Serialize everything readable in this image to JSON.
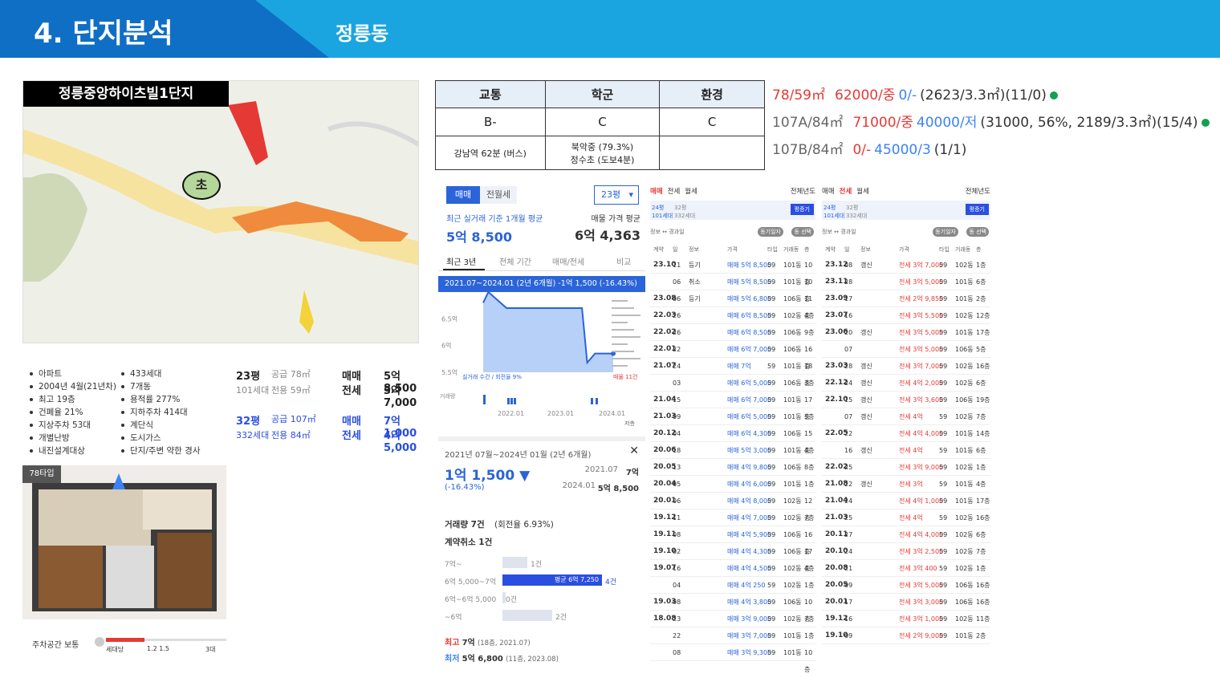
{
  "header": {
    "title": "4. 단지분석",
    "subtitle": "정릉동"
  },
  "map": {
    "label": "정릉중앙하이츠빌1단지",
    "school_marker": "초"
  },
  "info": {
    "left": [
      "아파트",
      "2004년 4월(21년차)",
      "최고 19층",
      "건폐율 21%",
      "지상주차 53대",
      "개별난방",
      "내진설계대상"
    ],
    "right": [
      "433세대",
      "7개동",
      "용적률 277%",
      "지하주차 414대",
      "계단식",
      "도시가스",
      "단지/주변 약한 경사"
    ]
  },
  "units": [
    {
      "py": "23평",
      "sub": "101세대",
      "supply": "공급 78㎡",
      "excl": "전용 59㎡",
      "t1": "매매",
      "p1": "5억 8,500",
      "t2": "전세",
      "p2": "3억 7,000",
      "hl": false
    },
    {
      "py": "32평",
      "sub": "332세대",
      "supply": "공급 107㎡",
      "excl": "전용 84㎡",
      "t1": "매매",
      "p1": "7억 1,000",
      "t2": "전세",
      "p2": "4억 5,000",
      "hl": true
    }
  ],
  "floor_tag": "78타입",
  "parking": {
    "label": "주차공간 보통",
    "per": "세대당",
    "ticks": "1.2 1.5",
    "max": "3대"
  },
  "env": {
    "headers": [
      "교통",
      "학군",
      "환경"
    ],
    "grades": [
      "B-",
      "C",
      "C"
    ],
    "details": [
      "강남역 62분 (버스)",
      "북악중 (79.3%)",
      "정수초 (도보4분)",
      ""
    ]
  },
  "types": [
    {
      "type": "78/59㎡",
      "sale": "62000/중",
      "rent": "0/-",
      "extra": "(2623/3.3㎡)(11/0)",
      "dot": true,
      "color": "#e53935"
    },
    {
      "type": "107A/84㎡",
      "sale": "71000/중",
      "rent": "40000/저",
      "extra": "(31000, 56%, 2189/3.3㎡)(15/4)",
      "dot": true,
      "color": "#666"
    },
    {
      "type": "107B/84㎡",
      "sale": "0/-",
      "rent": "45000/3",
      "extra": "(1/1)",
      "dot": false,
      "color": "#666"
    }
  ],
  "price_panel": {
    "tabs": [
      "매매",
      "전월세"
    ],
    "size_select": "23평",
    "recent_label": "최근 실거래 기준 1개월 평균",
    "recent_value": "5억 8,500",
    "ask_label": "매물 가격 평균",
    "ask_value": "6억 4,363",
    "period_tabs": [
      "최근 3년",
      "전체 기간",
      "매매/전세",
      "비교"
    ],
    "banner": "2021.07~2024.01 (2년 6개월)  -1억 1,500 (-16.43%)",
    "y_ticks": [
      "6.5억",
      "6억",
      "5.5억"
    ],
    "x_ticks": [
      "2022.01",
      "2023.01",
      "2024.01"
    ],
    "vol_label": "거래량",
    "legend": "실거래 수건 / 회전율 9%",
    "max_label": "최저",
    "ask_tag": "매물 11건",
    "note": "저층",
    "summary_period": "2021년 07월~2024년 01월 (2년 6개월)",
    "change": "1억 1,500 ▼",
    "change_pct": "(-16.43%)",
    "from_date": "2021.07",
    "from_val": "7억",
    "to_date": "2024.01",
    "to_val": "5억 8,500",
    "volume": "거래량 7건",
    "turnover": "(회전율 6.93%)",
    "cancel": "계약취소 1건",
    "bars": [
      {
        "label": "7억~",
        "count": "1건",
        "frac": 0.25
      },
      {
        "label": "6억 5,000~7억",
        "count": "4건",
        "frac": 1,
        "avg": "평균 6억 7,250"
      },
      {
        "label": "6억~6억 5,000",
        "count": "0건",
        "frac": 0
      },
      {
        "label": "~6억",
        "count": "2건",
        "frac": 0.5
      }
    ],
    "high": {
      "k": "최고",
      "v": "7억",
      "d": "(18층, 2021.07)"
    },
    "low": {
      "k": "최저",
      "v": "5억 6,800",
      "d": "(11층, 2023.08)"
    }
  },
  "chart_data": {
    "type": "line",
    "title": "",
    "x": [
      "2021.07",
      "2021.08",
      "2021.09",
      "2022.01",
      "2022.06",
      "2023.01",
      "2023.06",
      "2023.08",
      "2023.10",
      "2024.01"
    ],
    "values": [
      6.8,
      7.0,
      6.7,
      6.7,
      6.7,
      6.7,
      6.7,
      5.68,
      5.85,
      5.85
    ],
    "yunit": "억",
    "ylim": [
      5.5,
      7.0
    ]
  },
  "tx_left": {
    "tabs": [
      "매매",
      "전세",
      "월세"
    ],
    "year": "전체년도",
    "size_py": "24평",
    "size_sub": "101세대",
    "size2_py": "32평",
    "size2_sub": "332세대",
    "btn": "평증기",
    "info": "정보 ↔ 경과일",
    "b1": "동기일자",
    "b2": "동 선택",
    "cols": [
      "계약",
      "일",
      "정보",
      "가격",
      "타입",
      "거래동",
      "층"
    ],
    "rows": [
      [
        "23.10",
        "11",
        "등기",
        "매매 5억 8,500",
        "59",
        "101동",
        "10층"
      ],
      [
        "",
        "06",
        "취소",
        "매매 5억 8,500",
        "59",
        "101동",
        "10층"
      ],
      [
        "23.08",
        "06",
        "등기",
        "매매 5억 6,800",
        "59",
        "106동",
        "11층"
      ],
      [
        "22.03",
        "26",
        "",
        "매매 6억 8,500",
        "59",
        "102동",
        "4층"
      ],
      [
        "22.02",
        "26",
        "",
        "매매 6억 8,500",
        "59",
        "106동",
        "9층"
      ],
      [
        "22.01",
        "22",
        "",
        "매매 6억 7,000",
        "59",
        "106동",
        "16층"
      ],
      [
        "21.07",
        "24",
        "",
        "매매 7억",
        "59",
        "101동",
        "18층"
      ],
      [
        "",
        "03",
        "",
        "매매 6억 5,000",
        "59",
        "106동",
        "3층"
      ],
      [
        "21.04",
        "15",
        "",
        "매매 6억 7,000",
        "59",
        "101동",
        "17층"
      ],
      [
        "21.03",
        "09",
        "",
        "매매 6억 5,000",
        "59",
        "101동",
        "5층"
      ],
      [
        "20.12",
        "04",
        "",
        "매매 6억 4,300",
        "59",
        "106동",
        "15층"
      ],
      [
        "20.06",
        "18",
        "",
        "매매 5억 3,000",
        "59",
        "101동",
        "4층"
      ],
      [
        "20.05",
        "13",
        "",
        "매매 4억 9,800",
        "59",
        "106동",
        "8층"
      ],
      [
        "20.04",
        "05",
        "",
        "매매 4억 6,000",
        "59",
        "101동",
        "1층"
      ],
      [
        "20.01",
        "06",
        "",
        "매매 4억 8,000",
        "59",
        "102동",
        "12층"
      ],
      [
        "19.12",
        "11",
        "",
        "매매 4억 7,000",
        "59",
        "102동",
        "7층"
      ],
      [
        "19.11",
        "08",
        "",
        "매매 4억 5,900",
        "59",
        "106동",
        "16층"
      ],
      [
        "19.10",
        "02",
        "",
        "매매 4억 4,300",
        "59",
        "106동",
        "17층"
      ],
      [
        "19.07",
        "16",
        "",
        "매매 4억 4,500",
        "59",
        "102동",
        "4층"
      ],
      [
        "",
        "04",
        "",
        "매매 4억 250",
        "59",
        "102동",
        "1층"
      ],
      [
        "19.03",
        "08",
        "",
        "매매 4억 3,800",
        "59",
        "106동",
        "10층"
      ],
      [
        "18.08",
        "23",
        "",
        "매매 3억 9,000",
        "59",
        "102동",
        "7층"
      ],
      [
        "",
        "22",
        "",
        "매매 3억 7,000",
        "59",
        "101동",
        "1층"
      ],
      [
        "",
        "08",
        "",
        "매매 3억 9,300",
        "59",
        "101동",
        "10층"
      ]
    ]
  },
  "tx_right": {
    "tabs": [
      "매매",
      "전세",
      "월세"
    ],
    "year": "전체년도",
    "size_py": "24평",
    "size_sub": "101세대",
    "size2_py": "32평",
    "size2_sub": "332세대",
    "btn": "평증기",
    "info": "정보 ↔ 경과일",
    "b1": "동기일자",
    "b2": "동 선택",
    "cols": [
      "계약",
      "일",
      "정보",
      "가격",
      "타입",
      "거래동",
      "층"
    ],
    "rows": [
      [
        "23.12",
        "08",
        "갱신",
        "전세 3억 7,000",
        "59",
        "102동",
        "1층"
      ],
      [
        "23.11",
        "28",
        "",
        "전세 3억 5,000",
        "59",
        "101동",
        "6층"
      ],
      [
        "23.09",
        "17",
        "",
        "전세 2억 9,850",
        "59",
        "101동",
        "2층"
      ],
      [
        "23.07",
        "16",
        "",
        "전세 3억 5,500",
        "59",
        "102동",
        "12층"
      ],
      [
        "23.06",
        "20",
        "갱신",
        "전세 3억 5,000",
        "59",
        "101동",
        "17층"
      ],
      [
        "",
        "07",
        "",
        "전세 3억 5,000",
        "59",
        "106동",
        "5층"
      ],
      [
        "23.03",
        "28",
        "갱신",
        "전세 3억 7,000",
        "59",
        "102동",
        "16층"
      ],
      [
        "22.12",
        "24",
        "갱신",
        "전세 4억 2,000",
        "59",
        "102동",
        "6층"
      ],
      [
        "22.10",
        "15",
        "갱신",
        "전세 3억 3,600",
        "59",
        "106동",
        "19층"
      ],
      [
        "",
        "07",
        "갱신",
        "전세 4억",
        "59",
        "102동",
        "7층"
      ],
      [
        "22.05",
        "22",
        "",
        "전세 4억 4,000",
        "59",
        "101동",
        "14층"
      ],
      [
        "",
        "16",
        "갱신",
        "전세 4억",
        "59",
        "101동",
        "6층"
      ],
      [
        "22.02",
        "25",
        "",
        "전세 3억 9,000",
        "59",
        "102동",
        "1층"
      ],
      [
        "21.08",
        "22",
        "갱신",
        "전세 3억",
        "59",
        "101동",
        "4층"
      ],
      [
        "21.04",
        "24",
        "",
        "전세 4억 1,000",
        "59",
        "101동",
        "17층"
      ],
      [
        "21.03",
        "25",
        "",
        "전세 4억",
        "59",
        "102동",
        "16층"
      ],
      [
        "20.11",
        "27",
        "",
        "전세 4억 4,000",
        "59",
        "102동",
        "6층"
      ],
      [
        "20.10",
        "24",
        "",
        "전세 3억 2,500",
        "59",
        "102동",
        "7층"
      ],
      [
        "20.08",
        "21",
        "",
        "전세 3억 400",
        "59",
        "102동",
        "1층"
      ],
      [
        "20.05",
        "09",
        "",
        "전세 3억 5,000",
        "59",
        "106동",
        "16층"
      ],
      [
        "20.01",
        "17",
        "",
        "전세 3억 3,000",
        "59",
        "106동",
        "16층"
      ],
      [
        "19.12",
        "16",
        "",
        "전세 3억 1,000",
        "59",
        "102동",
        "11층"
      ],
      [
        "19.10",
        "09",
        "",
        "전세 2억 9,000",
        "59",
        "101동",
        "2층"
      ]
    ]
  }
}
